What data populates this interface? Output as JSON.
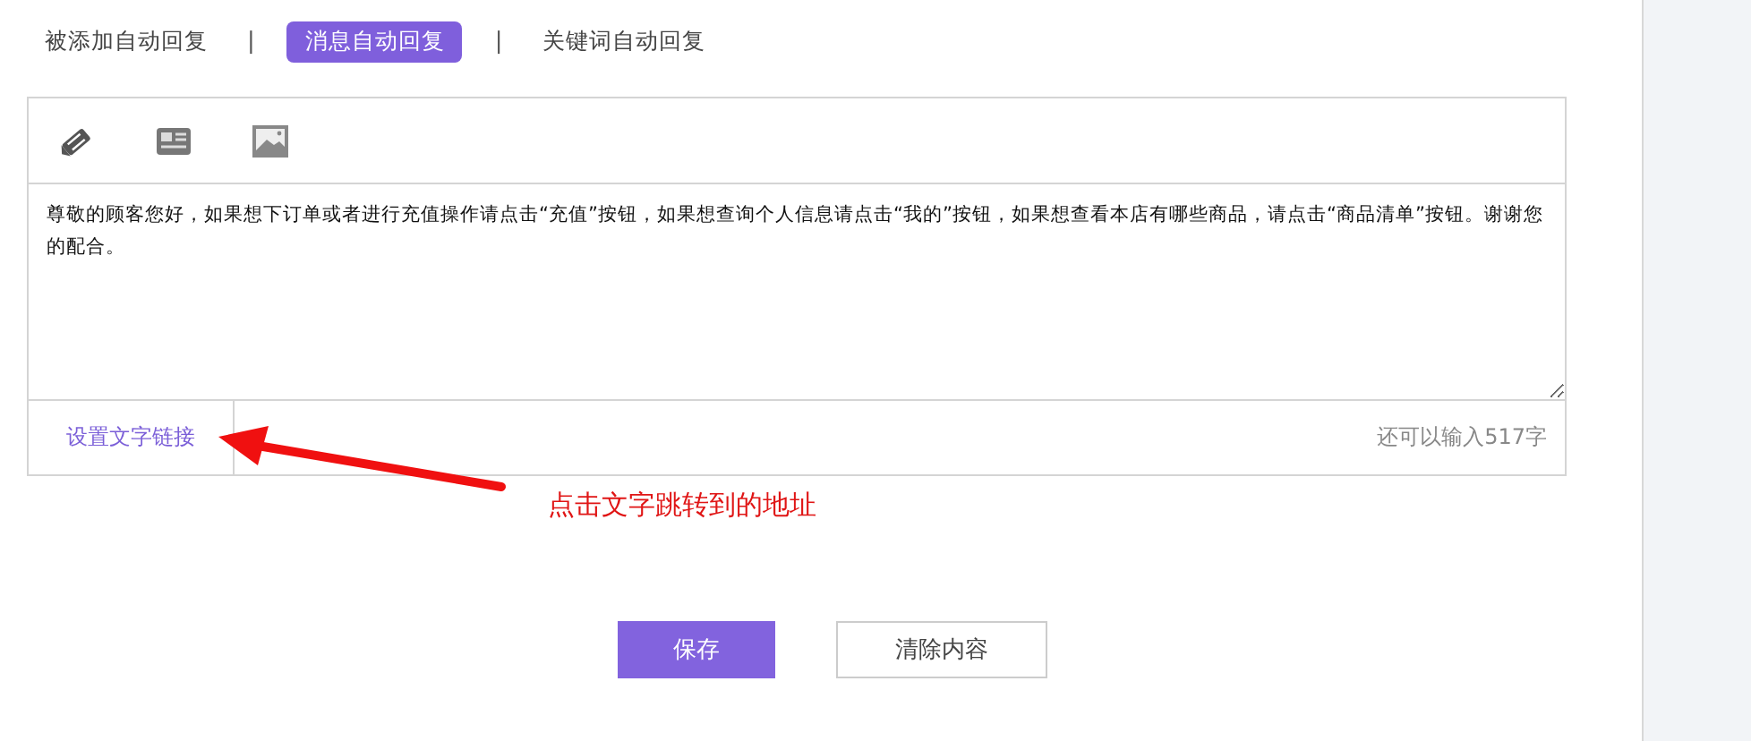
{
  "tabs": [
    {
      "label": "被添加自动回复",
      "selected": false
    },
    {
      "label": "消息自动回复",
      "selected": true
    },
    {
      "label": "关键词自动回复",
      "selected": false
    }
  ],
  "separators": [
    "|",
    "|"
  ],
  "editor": {
    "toolbar": [
      {
        "kind": "pencil"
      },
      {
        "kind": "news"
      },
      {
        "kind": "image"
      }
    ],
    "value": "尊敬的顾客您好，如果想下订单或者进行充值操作请点击“充值”按钮，如果想查询个人信息请点击“我的”按钮，如果想查看本店有哪些商品，请点击“商品清单”按钮。谢谢您的配合。",
    "link": "设置文字链接",
    "remaining": "还可以输入517字"
  },
  "annotation": {
    "text": "点击文字跳转到的地址"
  },
  "buttons": [
    {
      "label": "保存",
      "kind": "primary"
    },
    {
      "label": "清除内容",
      "kind": "default"
    }
  ]
}
